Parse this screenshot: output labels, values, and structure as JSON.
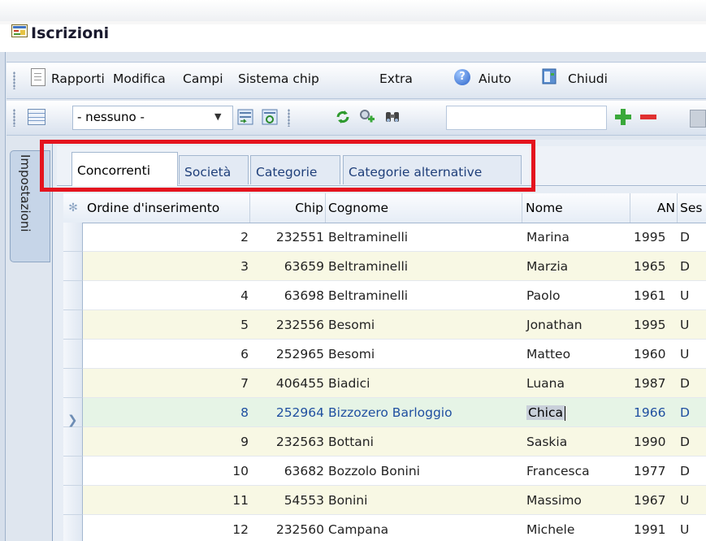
{
  "window": {
    "title": "Iscrizioni"
  },
  "menu": {
    "items": [
      "Rapporti",
      "Modifica",
      "Campi",
      "Sistema chip",
      "Extra"
    ],
    "help": "Aiuto",
    "close": "Chiudi"
  },
  "toolbar": {
    "combo_value": "- nessuno -",
    "search_value": ""
  },
  "sidetab": {
    "label": "Impostazioni"
  },
  "tabs": [
    {
      "label": "Concorrenti",
      "active": true
    },
    {
      "label": "Società",
      "active": false
    },
    {
      "label": "Categorie",
      "active": false
    },
    {
      "label": "Categorie alternative",
      "active": false
    }
  ],
  "grid": {
    "columns": [
      "Ordine d'inserimento",
      "Chip",
      "Cognome",
      "Nome",
      "AN",
      "Ses"
    ],
    "rows": [
      {
        "order": "2",
        "chip": "232551",
        "surname": "Beltraminelli",
        "name": "Marina",
        "year": "1995",
        "sex": "D"
      },
      {
        "order": "3",
        "chip": "63659",
        "surname": "Beltraminelli",
        "name": "Marzia",
        "year": "1965",
        "sex": "D"
      },
      {
        "order": "4",
        "chip": "63698",
        "surname": "Beltraminelli",
        "name": "Paolo",
        "year": "1961",
        "sex": "U"
      },
      {
        "order": "5",
        "chip": "232556",
        "surname": "Besomi",
        "name": "Jonathan",
        "year": "1995",
        "sex": "U"
      },
      {
        "order": "6",
        "chip": "252965",
        "surname": "Besomi",
        "name": "Matteo",
        "year": "1960",
        "sex": "U"
      },
      {
        "order": "7",
        "chip": "406455",
        "surname": "Biadici",
        "name": "Luana",
        "year": "1987",
        "sex": "D"
      },
      {
        "order": "8",
        "chip": "252964",
        "surname": "Bizzozero Barloggio",
        "name": "Chica",
        "year": "1966",
        "sex": "D"
      },
      {
        "order": "9",
        "chip": "232563",
        "surname": "Bottani",
        "name": "Saskia",
        "year": "1990",
        "sex": "D"
      },
      {
        "order": "10",
        "chip": "63682",
        "surname": "Bozzolo Bonini",
        "name": "Francesca",
        "year": "1977",
        "sex": "D"
      },
      {
        "order": "11",
        "chip": "54553",
        "surname": "Bonini",
        "name": "Massimo",
        "year": "1967",
        "sex": "U"
      },
      {
        "order": "12",
        "chip": "232560",
        "surname": "Campana",
        "name": "Michele",
        "year": "1991",
        "sex": "U"
      }
    ],
    "selected_index": 6
  },
  "colors": {
    "highlight": "#e4141e",
    "accent": "#1f4fa0"
  },
  "icons": [
    "form-icon",
    "report-doc-icon",
    "help-icon",
    "close-app-icon",
    "grid-layout-icon",
    "refresh-icon",
    "filter-icon",
    "binoculars-icon",
    "add-icon",
    "remove-icon",
    "save-icon"
  ]
}
